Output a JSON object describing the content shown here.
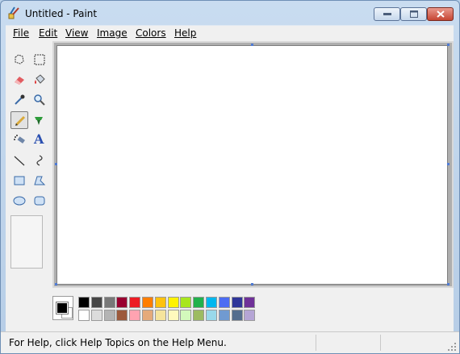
{
  "window": {
    "title": "Untitled - Paint"
  },
  "menu": [
    {
      "label": "File"
    },
    {
      "label": "Edit"
    },
    {
      "label": "View"
    },
    {
      "label": "Image"
    },
    {
      "label": "Colors"
    },
    {
      "label": "Help"
    }
  ],
  "tools": [
    {
      "name": "free-form-select-icon"
    },
    {
      "name": "select-icon"
    },
    {
      "name": "eraser-icon"
    },
    {
      "name": "fill-bucket-icon"
    },
    {
      "name": "pick-color-icon"
    },
    {
      "name": "magnifier-icon"
    },
    {
      "name": "pencil-icon",
      "selected": true
    },
    {
      "name": "brush-icon"
    },
    {
      "name": "airbrush-icon"
    },
    {
      "name": "text-icon",
      "label": "A"
    },
    {
      "name": "line-icon"
    },
    {
      "name": "curve-icon"
    },
    {
      "name": "rectangle-icon"
    },
    {
      "name": "polygon-icon"
    },
    {
      "name": "ellipse-icon"
    },
    {
      "name": "rounded-rectangle-icon"
    }
  ],
  "palette": {
    "foreground": "#000000",
    "background": "#ffffff",
    "row1": [
      "#000000",
      "#464646",
      "#787878",
      "#990030",
      "#ed1c24",
      "#ff7e00",
      "#ffc20e",
      "#fff200",
      "#a8e61d",
      "#22b14c",
      "#00b7ef",
      "#4d6df3",
      "#2f3699",
      "#6f3198"
    ],
    "row2": [
      "#ffffff",
      "#dcdcdc",
      "#b4b4b4",
      "#9c5a3c",
      "#ffa3b1",
      "#e5aa7a",
      "#f5e49c",
      "#fff9bd",
      "#d3f9bc",
      "#9dbb61",
      "#99d9ea",
      "#709ad1",
      "#546d8e",
      "#b5a5d5"
    ]
  },
  "status": {
    "text": "For Help, click Help Topics on the Help Menu."
  }
}
